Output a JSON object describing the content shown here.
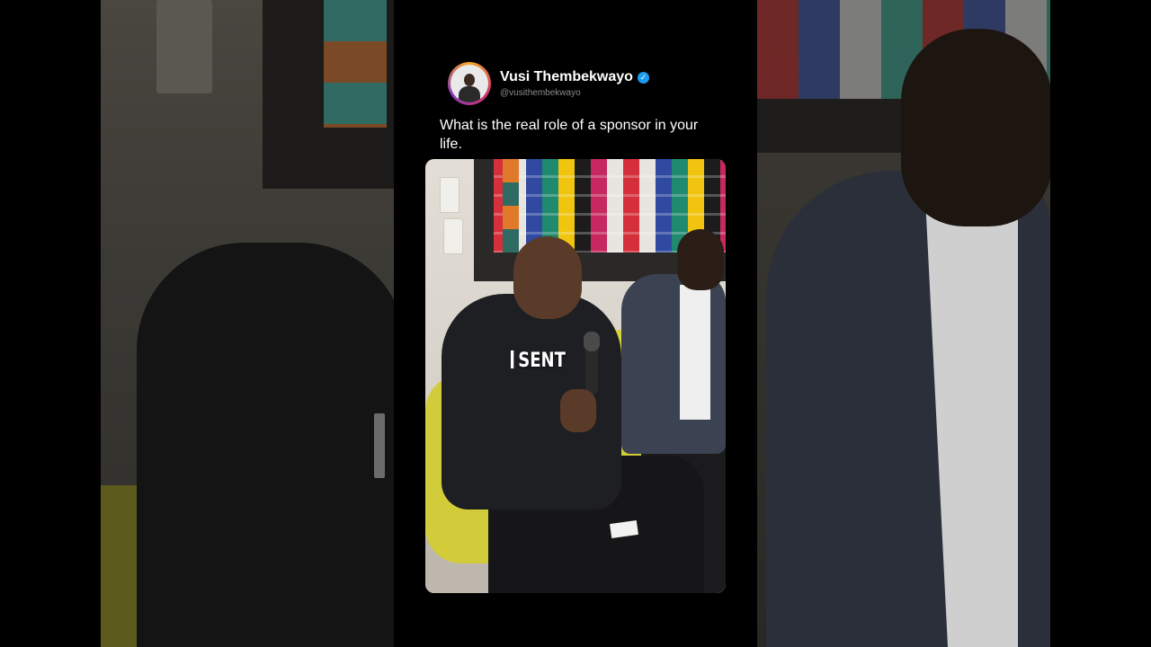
{
  "account": {
    "display_name": "Vusi Thembekwayo",
    "handle": "@vusithembekwayo",
    "verified": true
  },
  "tweet": {
    "text": "What is the real role of a sponsor in your life."
  },
  "video": {
    "caption": "SENT"
  },
  "colors": {
    "background": "#000000",
    "verified_badge": "#1d9bf0",
    "handle_text": "#8b8b8b"
  },
  "icons": {
    "verified": "verified-badge-icon",
    "avatar": "profile-avatar"
  }
}
